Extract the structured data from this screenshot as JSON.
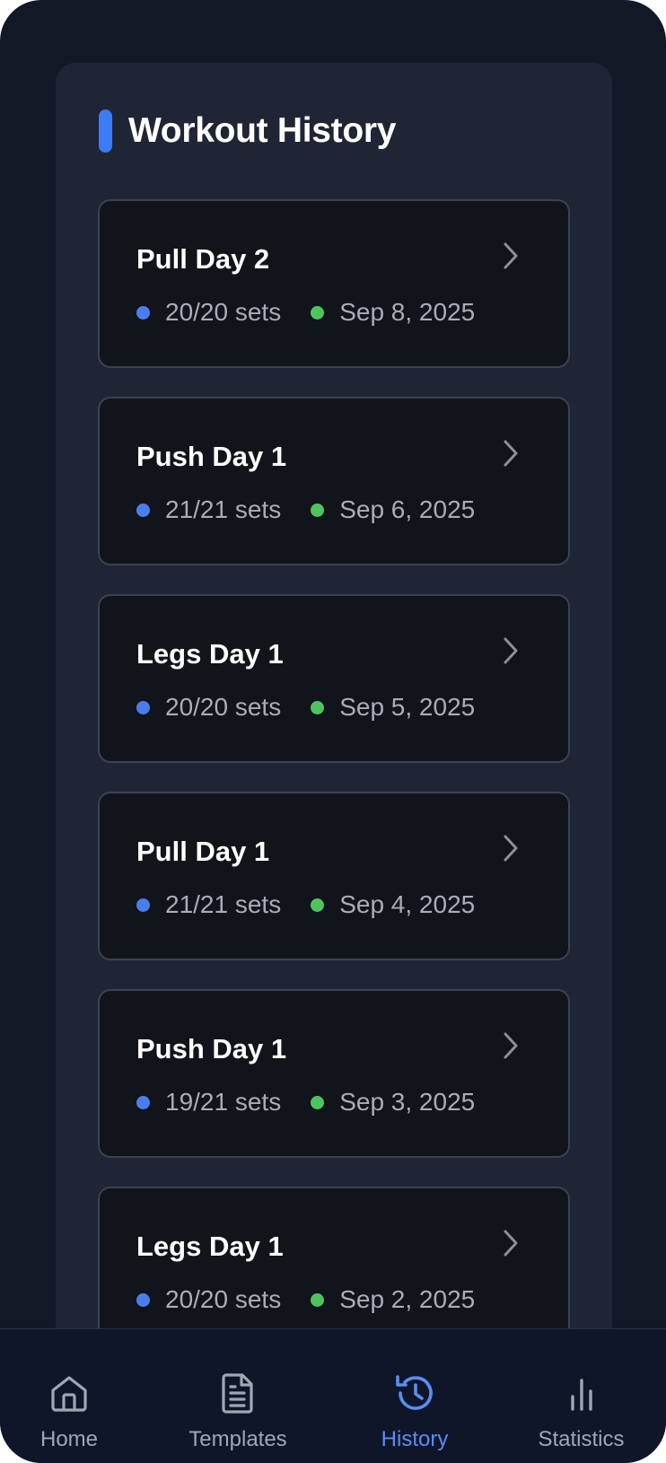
{
  "history": {
    "title": "Workout History",
    "accent_color": "#3d7cf7",
    "workouts": [
      {
        "name": "Pull Day 2",
        "sets": "20/20 sets",
        "date": "Sep 8, 2025"
      },
      {
        "name": "Push Day 1",
        "sets": "21/21 sets",
        "date": "Sep 6, 2025"
      },
      {
        "name": "Legs Day 1",
        "sets": "20/20 sets",
        "date": "Sep 5, 2025"
      },
      {
        "name": "Pull Day 1",
        "sets": "21/21 sets",
        "date": "Sep 4, 2025"
      },
      {
        "name": "Push Day 1",
        "sets": "19/21 sets",
        "date": "Sep 3, 2025"
      },
      {
        "name": "Legs Day 1",
        "sets": "20/20 sets",
        "date": "Sep 2, 2025"
      }
    ],
    "status_colors": {
      "sets": "#4a7ef0",
      "date": "#4fc45e"
    }
  },
  "tabbar": {
    "tabs": [
      {
        "label": "Home",
        "icon": "home-icon",
        "active": false
      },
      {
        "label": "Templates",
        "icon": "document-icon",
        "active": false
      },
      {
        "label": "History",
        "icon": "history-clock-icon",
        "active": true
      },
      {
        "label": "Statistics",
        "icon": "bar-chart-icon",
        "active": false
      }
    ],
    "active_color": "#5b8def",
    "inactive_color": "#a0a6b2"
  }
}
